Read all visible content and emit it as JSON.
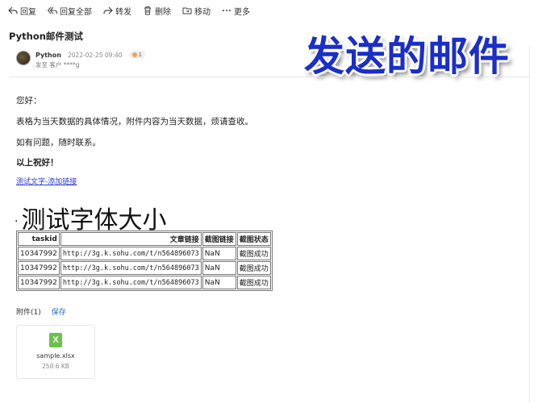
{
  "toolbar": {
    "reply": "回复",
    "reply_all": "回复全部",
    "forward": "转发",
    "delete": "删除",
    "move": "移动",
    "more": "更多"
  },
  "overlay_title": "发送的邮件",
  "email": {
    "subject": "Python邮件测试",
    "sender_name": "Python",
    "date": "2022-02-25 09:40",
    "badge_count": "1",
    "to_line": "发至 客户 ****g"
  },
  "body": {
    "greeting": "您好：",
    "line1": "表格为当天数据的具体情况，附件内容为当天数据，烦请查收。",
    "line2": "如有问题，随时联系。",
    "closing": "以上祝好！",
    "link_text": "测试文字-添加链接",
    "big_title_dot": "·",
    "big_title": "测试字体大小"
  },
  "table": {
    "headers": [
      "taskid",
      "文章链接",
      "截图链接",
      "截图状态"
    ],
    "rows": [
      [
        "10347992",
        "http://3g.k.sohu.com/t/n564896073",
        "NaN",
        "截图成功"
      ],
      [
        "10347992",
        "http://3g.k.sohu.com/t/n564896073",
        "NaN",
        "截图成功"
      ],
      [
        "10347992",
        "http://3g.k.sohu.com/t/n564896073",
        "NaN",
        "截图成功"
      ]
    ]
  },
  "attachments": {
    "label": "附件(1)",
    "save": "保存",
    "file_icon_letter": "X",
    "file_name": "sample.xlsx",
    "file_size": "250.6 KB"
  },
  "colors": {
    "overlay_title": "#1a2ec9",
    "link": "#2a3bd0",
    "excel_icon": "#6bc24a"
  }
}
